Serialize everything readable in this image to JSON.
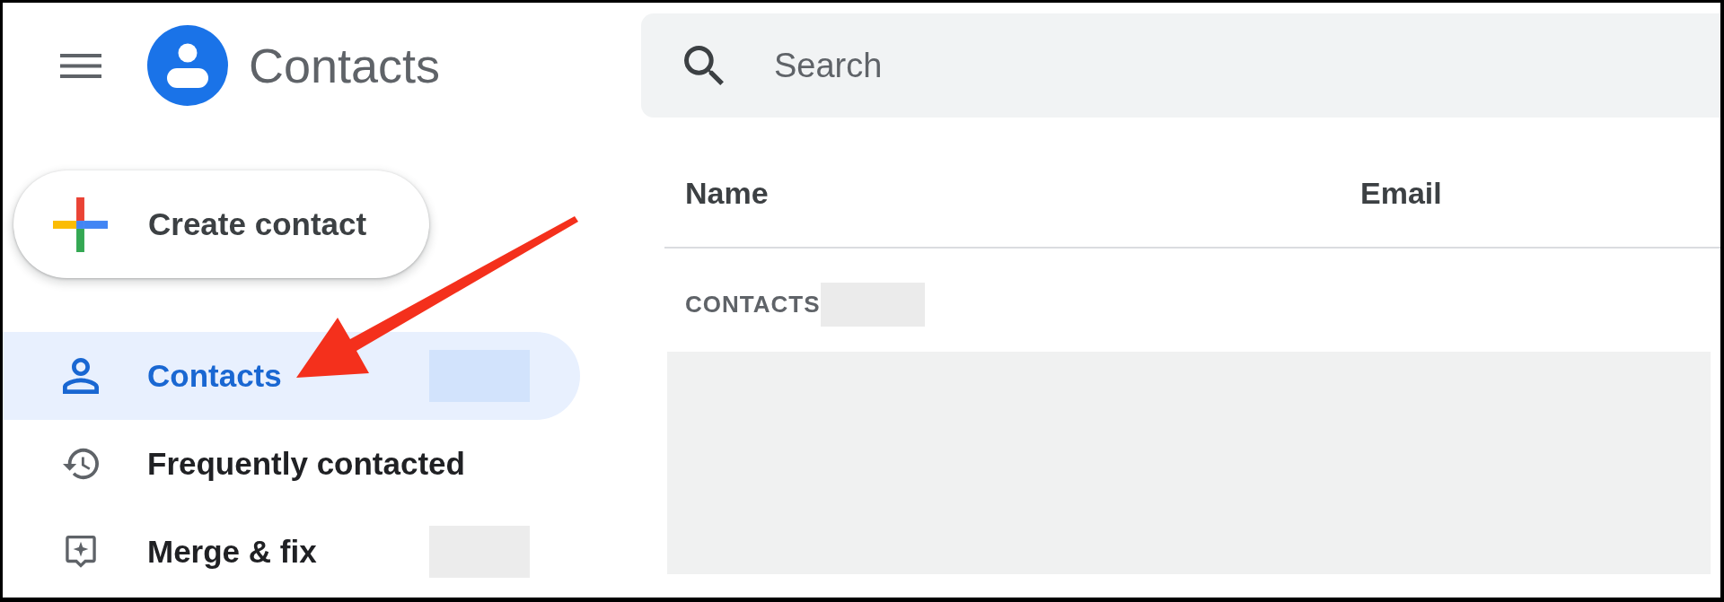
{
  "app": {
    "title": "Contacts"
  },
  "search": {
    "placeholder": "Search"
  },
  "create_button": {
    "label": "Create contact"
  },
  "sidebar": {
    "items": [
      {
        "label": "Contacts",
        "selected": true,
        "count_covered": true
      },
      {
        "label": "Frequently contacted",
        "selected": false,
        "count_covered": false
      },
      {
        "label": "Merge & fix",
        "selected": false,
        "count_covered": true
      }
    ]
  },
  "table": {
    "columns": [
      "Name",
      "Email"
    ],
    "section_label": "CONTACTS",
    "section_count_covered": true,
    "rows_covered": true
  }
}
